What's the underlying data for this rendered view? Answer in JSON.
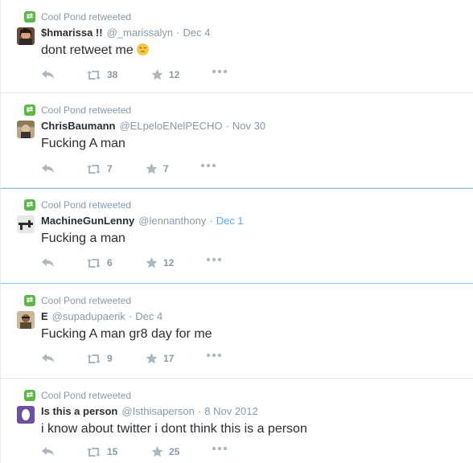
{
  "colors": {
    "accent": "#55acee",
    "retweet_green": "#5fb64a",
    "muted": "#8899a6",
    "text": "#292f33"
  },
  "tweets": [
    {
      "retweeted_by": "Cool Pond retweeted",
      "fullname": "$hmarissa !!",
      "username": "@_marissalyn",
      "time": "Dec 4",
      "text": "dont retweet me",
      "emoji": "relieved-face",
      "retweets": "38",
      "favorites": "12"
    },
    {
      "retweeted_by": "Cool Pond retweeted",
      "fullname": "ChrisBaumann",
      "username": "@ELpeloENelPECHO",
      "time": "Nov 30",
      "text": "Fucking A man",
      "retweets": "7",
      "favorites": "7"
    },
    {
      "retweeted_by": "Cool Pond retweeted",
      "fullname": "MachineGunLenny",
      "username": "@lennanthony",
      "time": "Dec 1",
      "text": "Fucking a man",
      "retweets": "6",
      "favorites": "12"
    },
    {
      "retweeted_by": "Cool Pond retweeted",
      "fullname": "E",
      "username": "@supadupaerik",
      "time": "Dec 4",
      "text": "Fucking A man gr8 day for me",
      "retweets": "9",
      "favorites": "17"
    },
    {
      "retweeted_by": "Cool Pond retweeted",
      "fullname": "Is this a person",
      "username": "@Isthisaperson",
      "time": "8 Nov 2012",
      "text": "i know about twitter i dont think this is a person",
      "retweets": "15",
      "favorites": "25"
    }
  ]
}
